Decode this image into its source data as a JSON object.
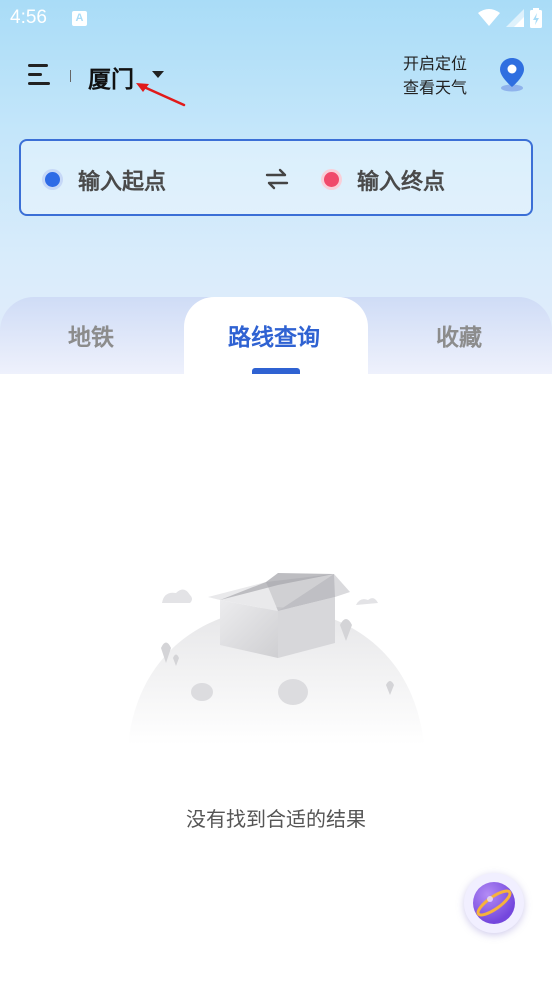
{
  "status_bar": {
    "time": "4:56",
    "notification_icon": "A"
  },
  "header": {
    "city": "厦门",
    "location_line1": "开启定位",
    "location_line2": "查看天气"
  },
  "route_input": {
    "start_placeholder": "输入起点",
    "end_placeholder": "输入终点"
  },
  "tabs": [
    {
      "label": "地铁"
    },
    {
      "label": "路线查询"
    },
    {
      "label": "收藏"
    }
  ],
  "active_tab": "路线查询",
  "empty_state": {
    "message": "没有找到合适的结果"
  },
  "colors": {
    "accent": "#2f62d2",
    "start_dot": "#2e6be6",
    "end_dot": "#f04a6b",
    "header_bg": "#a9dcf7"
  },
  "icons": {
    "menu": "hamburger-icon",
    "dropdown": "caret-down-icon",
    "location": "location-pin-icon",
    "swap": "swap-arrows-icon",
    "fab": "planet-icon"
  }
}
